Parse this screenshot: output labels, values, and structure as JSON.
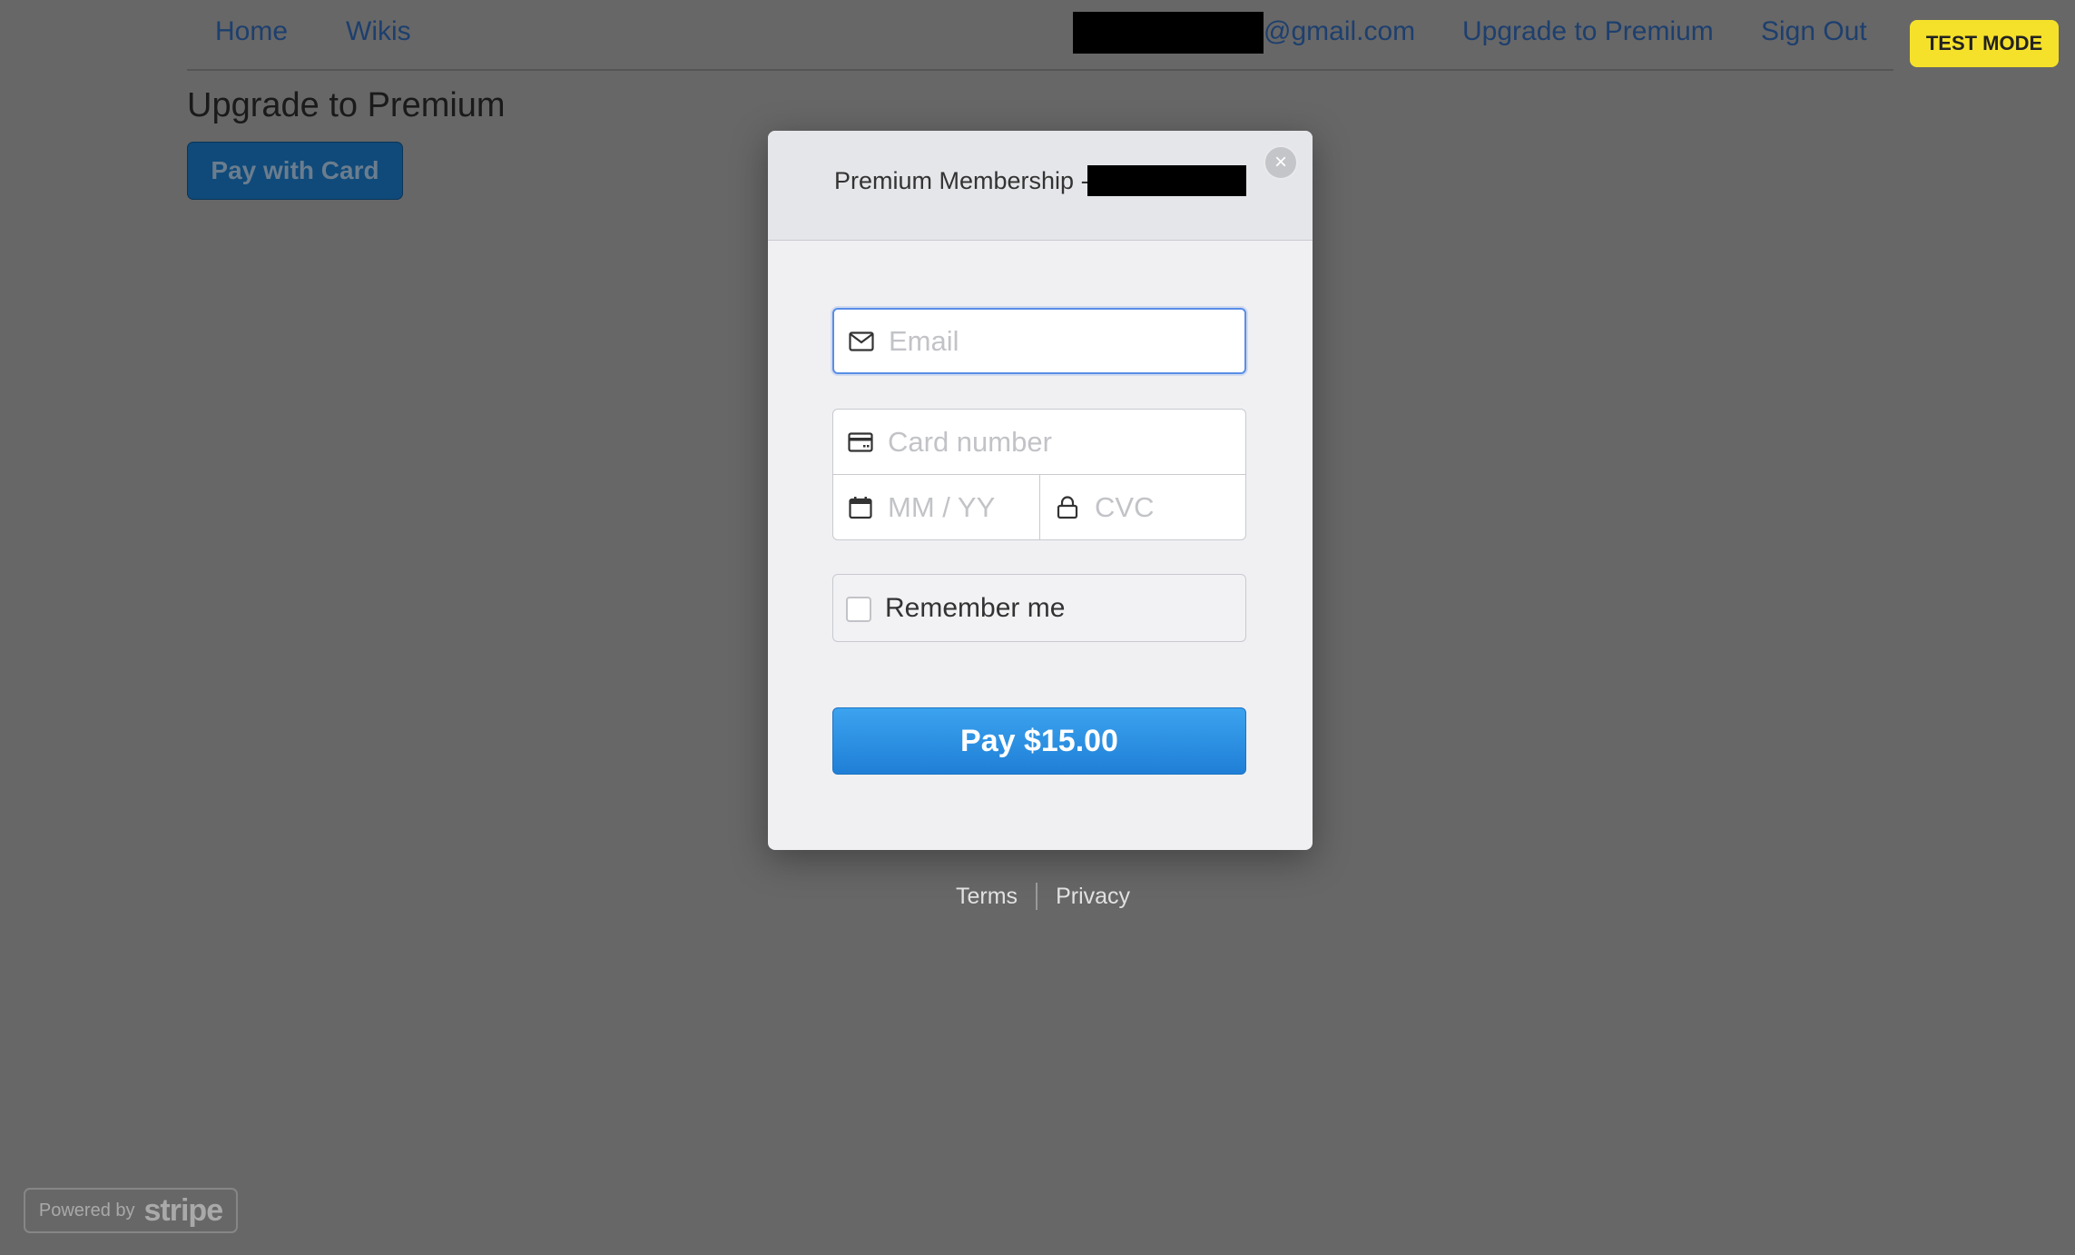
{
  "nav": {
    "home": "Home",
    "wikis": "Wikis",
    "email_suffix": "@gmail.com",
    "upgrade": "Upgrade to Premium",
    "sign_out": "Sign Out"
  },
  "test_mode_badge": "TEST MODE",
  "page": {
    "title": "Upgrade to Premium",
    "pay_with_card": "Pay with Card"
  },
  "modal": {
    "title": "Premium Membership -",
    "email_placeholder": "Email",
    "card_number_placeholder": "Card number",
    "expiry_placeholder": "MM / YY",
    "cvc_placeholder": "CVC",
    "remember_me": "Remember me",
    "pay_button": "Pay $15.00"
  },
  "footer": {
    "terms": "Terms",
    "privacy": "Privacy"
  },
  "powered_by": {
    "prefix": "Powered by",
    "brand": "stripe"
  },
  "colors": {
    "overlay_background": "#676767",
    "pay_button": "#2b8fe4",
    "test_mode_badge": "#f5e12a",
    "focus_ring": "#5a8ee6"
  },
  "icons": [
    "mail-icon",
    "credit-card-icon",
    "calendar-icon",
    "lock-icon",
    "close-icon",
    "checkbox"
  ]
}
